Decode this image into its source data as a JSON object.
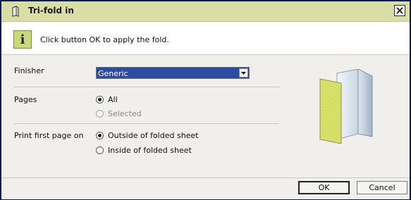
{
  "window": {
    "title": "Tri-fold in"
  },
  "info": {
    "message": "Click button OK to apply the fold."
  },
  "finisher": {
    "label": "Finisher",
    "selected": "Generic"
  },
  "pages": {
    "label": "Pages",
    "options": [
      "All",
      "Selected"
    ],
    "selected": "All"
  },
  "print_first_page": {
    "label": "Print first page on",
    "options": [
      "Outside of folded sheet",
      "Inside of folded sheet"
    ],
    "selected": "Outside of folded sheet"
  },
  "buttons": {
    "ok": "OK",
    "cancel": "Cancel"
  },
  "colors": {
    "titlebar": "#d8dea4",
    "selection": "#2c4ca1",
    "fold_front": "#d9e26a",
    "border": "#0b1f4d"
  }
}
